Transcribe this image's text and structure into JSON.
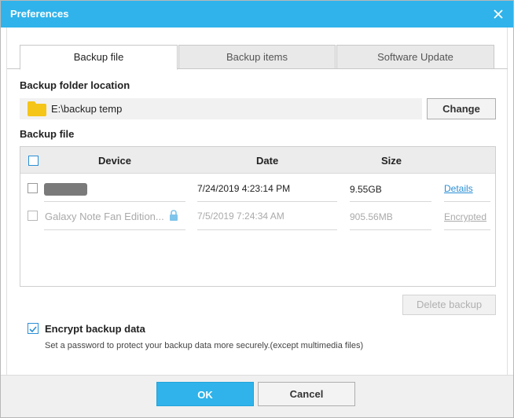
{
  "window": {
    "title": "Preferences"
  },
  "tabs": [
    {
      "label": "Backup file",
      "active": true
    },
    {
      "label": "Backup items",
      "active": false
    },
    {
      "label": "Software Update",
      "active": false
    }
  ],
  "backup_folder": {
    "label": "Backup folder location",
    "path": "E:\\backup temp",
    "change_label": "Change"
  },
  "backup_file": {
    "label": "Backup file",
    "columns": {
      "device": "Device",
      "date": "Date",
      "size": "Size"
    },
    "rows": [
      {
        "device": "",
        "date": "7/24/2019 4:23:14 PM",
        "size": "9.55GB",
        "action": "Details",
        "enabled": true,
        "checked": false
      },
      {
        "device": "Galaxy Note Fan Edition...",
        "date": "7/5/2019 7:24:34 AM",
        "size": "905.56MB",
        "action": "Encrypted",
        "enabled": false,
        "checked": false,
        "locked": true
      }
    ],
    "delete_label": "Delete backup"
  },
  "encrypt": {
    "label": "Encrypt backup data",
    "checked": true,
    "description": "Set a password to protect your backup data more securely.(except multimedia files)"
  },
  "footer": {
    "ok_label": "OK",
    "cancel_label": "Cancel"
  },
  "colors": {
    "accent": "#2fb3ea",
    "link": "#2b8fd6",
    "folder": "#f5c518",
    "lock": "#7fc4ea"
  }
}
